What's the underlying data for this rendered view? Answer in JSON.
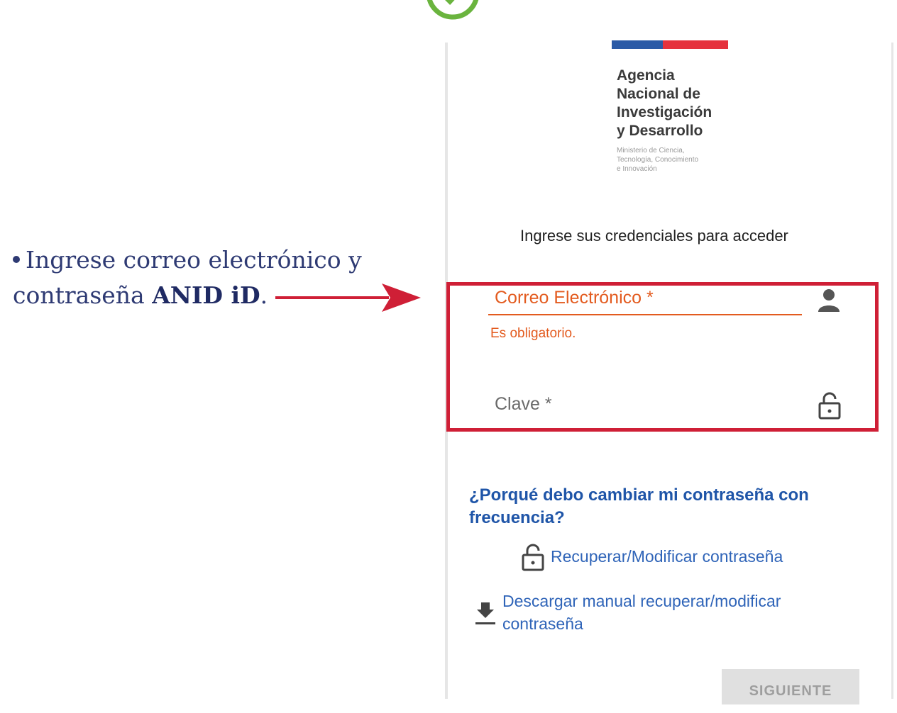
{
  "instruction": {
    "line1": "Ingrese correo electrónico y",
    "line2_prefix": "contraseña ",
    "line2_bold": "ANID iD",
    "line2_suffix": "."
  },
  "agency": {
    "name_lines": [
      "Agencia",
      "Nacional de",
      "Investigación",
      "y Desarrollo"
    ],
    "ministry_lines": [
      "Ministerio de Ciencia,",
      "Tecnología, Conocimiento",
      "e Innovación"
    ]
  },
  "form": {
    "subtitle": "Ingrese sus credenciales para acceder",
    "email_label": "Correo Electrónico *",
    "email_error": "Es obligatorio.",
    "password_label": "Clave *"
  },
  "links": {
    "why_change": "¿Porqué debo cambiar mi contraseña con frecuencia?",
    "recover": "Recuperar/Modificar contraseña",
    "download_line1": "Descargar manual recuperar/modificar",
    "download_line2": "contraseña"
  },
  "buttons": {
    "next": "SIGUIENTE"
  },
  "colors": {
    "highlight": "#cf1f36",
    "error": "#e35b1f",
    "link": "#1f55a8",
    "instruction_text": "#2e3a73",
    "check_green": "#6ab43e"
  },
  "icons": [
    "check-circle-icon",
    "arrow-right-icon",
    "user-icon",
    "lock-icon",
    "download-icon"
  ]
}
